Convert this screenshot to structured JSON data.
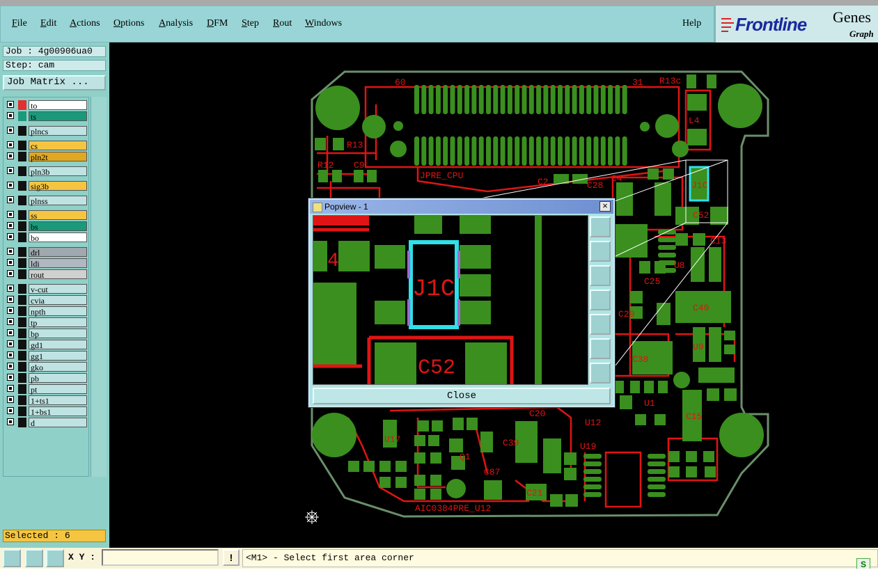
{
  "menubar": {
    "items": [
      "File",
      "Edit",
      "Actions",
      "Options",
      "Analysis",
      "DFM",
      "Step",
      "Rout",
      "Windows"
    ],
    "help": "Help"
  },
  "logo": {
    "brand": "Frontline",
    "product": "Genes",
    "sub": "Graph"
  },
  "info": {
    "job": "Job : 4g00906ua0",
    "step": "Step: cam",
    "job_matrix": "Job Matrix ..."
  },
  "layers": [
    {
      "name": "to",
      "color": "#ffffff"
    },
    {
      "name": "ts",
      "color": "#1a9a7a"
    },
    {
      "name": "plncs",
      "color": "#bfe3e3"
    },
    {
      "name": "cs",
      "color": "#f5c542"
    },
    {
      "name": "pln2t",
      "color": "#e0a820"
    },
    {
      "name": "pln3b",
      "color": "#bfe3e3"
    },
    {
      "name": "sig3b",
      "color": "#f5c542"
    },
    {
      "name": "plnss",
      "color": "#bfe3e3"
    },
    {
      "name": "ss",
      "color": "#f5c542"
    },
    {
      "name": "bs",
      "color": "#1a9a7a"
    },
    {
      "name": "bo",
      "color": "#ffffff"
    },
    {
      "name": "drl",
      "color": "#a0a8b0"
    },
    {
      "name": "ldi",
      "color": "#b0b8c0"
    },
    {
      "name": "rout",
      "color": "#d0d0d0"
    },
    {
      "name": "v-cut",
      "color": "#bfe3e3"
    },
    {
      "name": "cvia",
      "color": "#bfe3e3"
    },
    {
      "name": "npth",
      "color": "#bfe3e3"
    },
    {
      "name": "tp",
      "color": "#bfe3e3"
    },
    {
      "name": "bp",
      "color": "#bfe3e3"
    },
    {
      "name": "gd1",
      "color": "#bfe3e3"
    },
    {
      "name": "gg1",
      "color": "#bfe3e3"
    },
    {
      "name": "gko",
      "color": "#bfe3e3"
    },
    {
      "name": "pb",
      "color": "#bfe3e3"
    },
    {
      "name": "pt",
      "color": "#bfe3e3"
    },
    {
      "name": "1+ts1",
      "color": "#bfe3e3"
    },
    {
      "name": "1+bs1",
      "color": "#bfe3e3"
    },
    {
      "name": "d",
      "color": "#bfe3e3"
    }
  ],
  "selected": "Selected : 6",
  "status": {
    "xy_label": "X Y :",
    "xy_value": "",
    "bang": "!",
    "message": "<M1> - Select first area corner"
  },
  "popview": {
    "title": "Popview - 1",
    "close": "Close",
    "close_x": "×"
  },
  "board_labels": [
    "60",
    "31",
    "R13c",
    "L4",
    "R13",
    "R12",
    "C9",
    "JPRE_CPU",
    "C2",
    "C28",
    "C4",
    "J1C",
    "C52",
    "C13",
    "U8",
    "C25",
    "C29",
    "C40",
    "U9",
    "C38",
    "U1",
    "C20",
    "U12",
    "C39",
    "U19",
    "Q1",
    "C87",
    "C21",
    "AIC0384PRE_U12",
    "C15",
    "U17"
  ],
  "pop_labels": [
    "J1C",
    "C52",
    "4"
  ],
  "colors": {
    "pad": "#3a8f1e",
    "trace": "#e01414",
    "outline": "#6b8f6b",
    "highlight": "#2fe0e8"
  }
}
